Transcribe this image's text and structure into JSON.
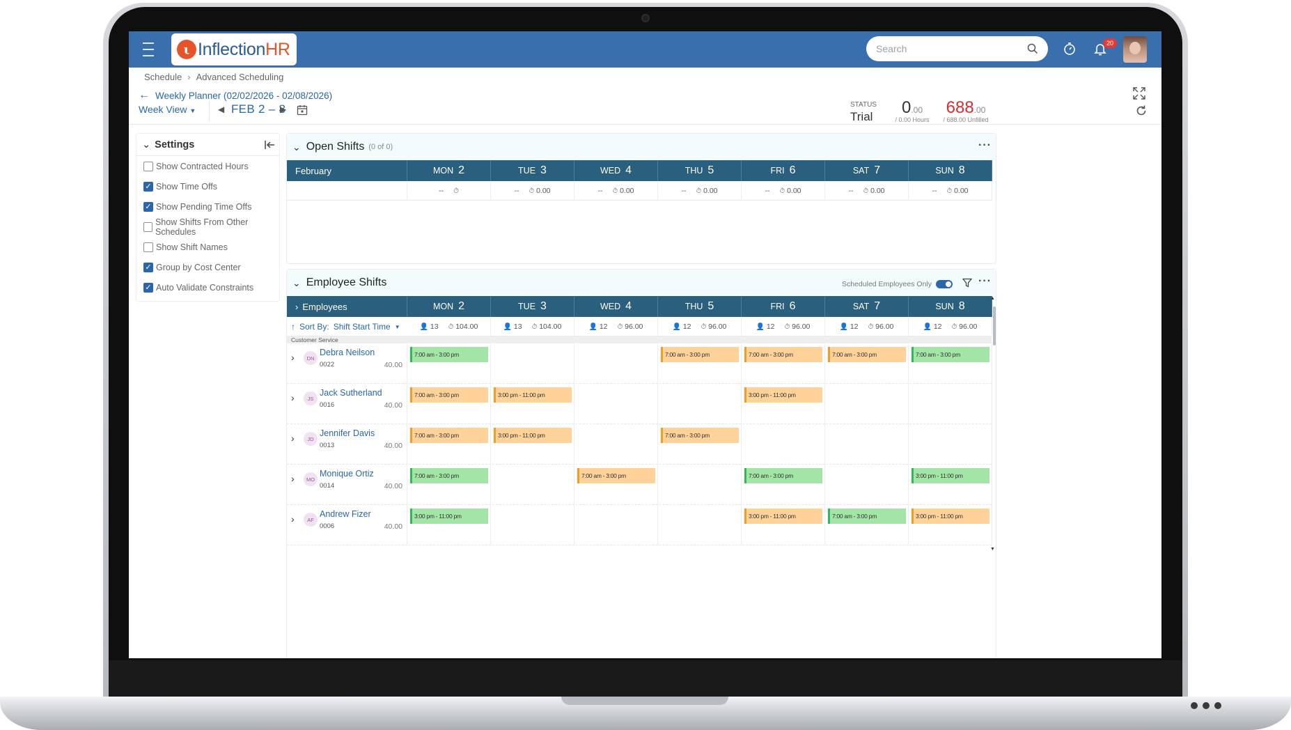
{
  "app": {
    "brand_prefix": "Inflection",
    "brand_suffix": "HR",
    "search_placeholder": "Search",
    "notification_count": "20"
  },
  "breadcrumb": [
    "Schedule",
    "Advanced Scheduling"
  ],
  "page_title": "Weekly Planner (02/02/2026 - 02/08/2026)",
  "toolbar": {
    "view_label": "Week View",
    "date_range": "FEB 2 – 8",
    "status_label": "STATUS",
    "status_value": "Trial",
    "hours_value": "0",
    "hours_decimal": ".00",
    "hours_sub": "/ 0.00 Hours",
    "unfilled_value": "688",
    "unfilled_decimal": ".00",
    "unfilled_sub": "/ 688.00 Unfilled"
  },
  "settings": {
    "title": "Settings",
    "options": [
      {
        "label": "Show Contracted Hours",
        "checked": false
      },
      {
        "label": "Show Time Offs",
        "checked": true
      },
      {
        "label": "Show Pending Time Offs",
        "checked": true
      },
      {
        "label": "Show Shifts From Other Schedules",
        "checked": false
      },
      {
        "label": "Show Shift Names",
        "checked": false
      },
      {
        "label": "Group by Cost Center",
        "checked": true
      },
      {
        "label": "Auto Validate Constraints",
        "checked": true
      }
    ]
  },
  "days": [
    {
      "name": "MON",
      "date": "2"
    },
    {
      "name": "TUE",
      "date": "3"
    },
    {
      "name": "WED",
      "date": "4"
    },
    {
      "name": "THU",
      "date": "5"
    },
    {
      "name": "FRI",
      "date": "6"
    },
    {
      "name": "SAT",
      "date": "7"
    },
    {
      "name": "SUN",
      "date": "8"
    }
  ],
  "open_shifts": {
    "title": "Open Shifts",
    "count": "(0 of 0)",
    "month_label": "February",
    "summary": [
      {
        "count": "--",
        "hours": ""
      },
      {
        "count": "--",
        "hours": "0.00"
      },
      {
        "count": "--",
        "hours": "0.00"
      },
      {
        "count": "--",
        "hours": "0.00"
      },
      {
        "count": "--",
        "hours": "0.00"
      },
      {
        "count": "--",
        "hours": "0.00"
      },
      {
        "count": "--",
        "hours": "0.00"
      }
    ]
  },
  "employee_shifts": {
    "title": "Employee Shifts",
    "toggle_label": "Scheduled Employees Only",
    "employees_header": "Employees",
    "sort_label": "Sort By:",
    "sort_value": "Shift Start Time",
    "summary": [
      {
        "count": "13",
        "hours": "104.00"
      },
      {
        "count": "13",
        "hours": "104.00"
      },
      {
        "count": "12",
        "hours": "96.00"
      },
      {
        "count": "12",
        "hours": "96.00"
      },
      {
        "count": "12",
        "hours": "96.00"
      },
      {
        "count": "12",
        "hours": "96.00"
      },
      {
        "count": "12",
        "hours": "96.00"
      }
    ],
    "group": "Customer Service",
    "rows": [
      {
        "initials": "DN",
        "name": "Debra Neilson",
        "id": "0022",
        "hours": "40.00",
        "shifts": [
          {
            "text": "7:00 am - 3:00 pm",
            "color": "green"
          },
          null,
          null,
          {
            "text": "7:00 am - 3:00 pm",
            "color": "orange"
          },
          {
            "text": "7:00 am - 3:00 pm",
            "color": "orange"
          },
          {
            "text": "7:00 am - 3:00 pm",
            "color": "orange"
          },
          {
            "text": "7:00 am - 3:00 pm",
            "color": "green"
          }
        ]
      },
      {
        "initials": "JS",
        "name": "Jack Sutherland",
        "id": "0016",
        "hours": "40.00",
        "shifts": [
          {
            "text": "7:00 am - 3:00 pm",
            "color": "orange"
          },
          {
            "text": "3:00 pm - 11:00 pm",
            "color": "orange"
          },
          null,
          null,
          {
            "text": "3:00 pm - 11:00 pm",
            "color": "orange"
          },
          null,
          null
        ]
      },
      {
        "initials": "JD",
        "name": "Jennifer Davis",
        "id": "0013",
        "hours": "40.00",
        "shifts": [
          {
            "text": "7:00 am - 3:00 pm",
            "color": "orange"
          },
          {
            "text": "3:00 pm - 11:00 pm",
            "color": "orange"
          },
          null,
          {
            "text": "7:00 am - 3:00 pm",
            "color": "orange"
          },
          null,
          null,
          null
        ]
      },
      {
        "initials": "MO",
        "name": "Monique Ortiz",
        "id": "0014",
        "hours": "40.00",
        "shifts": [
          {
            "text": "7:00 am - 3:00 pm",
            "color": "green"
          },
          null,
          {
            "text": "7:00 am - 3:00 pm",
            "color": "orange"
          },
          null,
          {
            "text": "7:00 am - 3:00 pm",
            "color": "green"
          },
          null,
          {
            "text": "3:00 pm - 11:00 pm",
            "color": "green"
          }
        ]
      },
      {
        "initials": "AF",
        "name": "Andrew Fizer",
        "id": "0006",
        "hours": "40.00",
        "shifts": [
          {
            "text": "3:00 pm - 11:00 pm",
            "color": "green"
          },
          null,
          null,
          null,
          {
            "text": "3:00 pm - 11:00 pm",
            "color": "orange"
          },
          {
            "text": "7:00 am - 3:00 pm",
            "color": "green"
          },
          {
            "text": "3:00 pm - 11:00 pm",
            "color": "orange"
          }
        ]
      }
    ]
  },
  "colors": {
    "topbar": "#3a6fad",
    "grid_header": "#2b5f7e",
    "accent": "#2a66a8",
    "shift_green": "#a3e4a7",
    "shift_orange": "#ffd29a",
    "unfilled_red": "#d32f2f"
  }
}
